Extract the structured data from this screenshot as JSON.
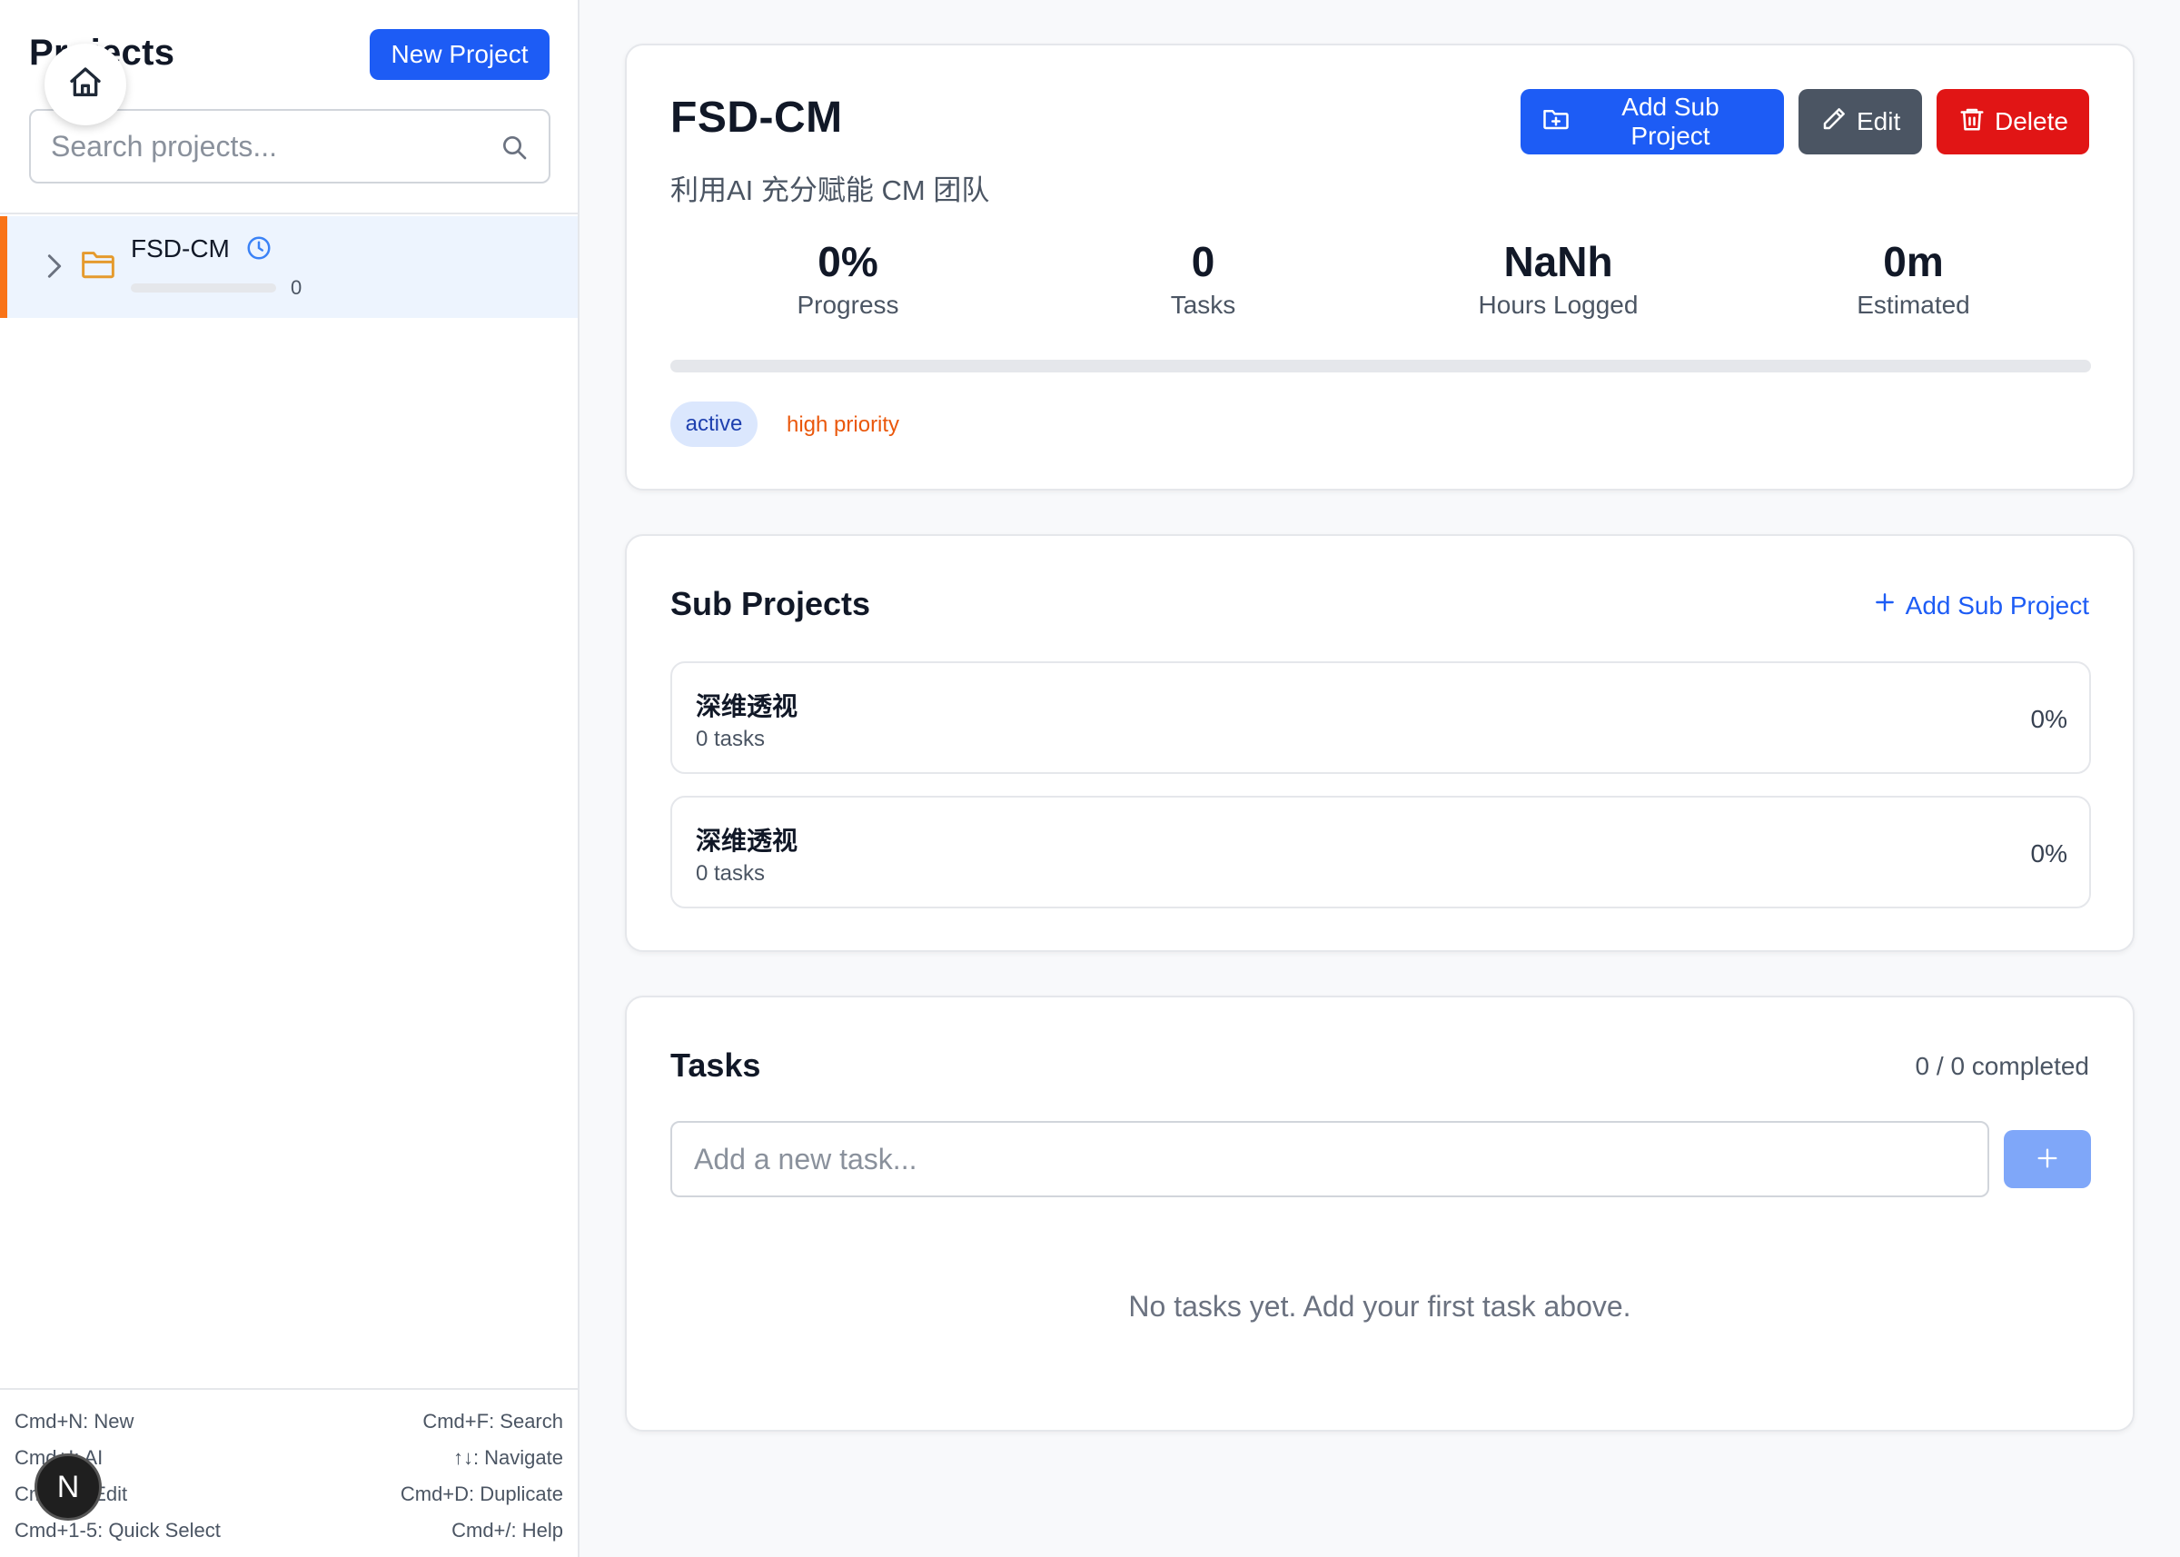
{
  "sidebar": {
    "title": "Projects",
    "new_button": "New Project",
    "search_placeholder": "Search projects...",
    "tree": [
      {
        "name": "FSD-CM",
        "count": "0",
        "progress": 0
      }
    ],
    "shortcuts": {
      "left": [
        "Cmd+N: New",
        "Cmd+I: AI",
        "Cmd+E: Edit",
        "Cmd+1-5: Quick Select"
      ],
      "right": [
        "Cmd+F: Search",
        "↑↓: Navigate",
        "Cmd+D: Duplicate",
        "Cmd+/: Help"
      ]
    },
    "badge": "N"
  },
  "project": {
    "title": "FSD-CM",
    "description": "利用AI 充分赋能 CM 团队",
    "buttons": {
      "add_sub": "Add Sub Project",
      "edit": "Edit",
      "delete": "Delete"
    },
    "stats": [
      {
        "value": "0%",
        "label": "Progress"
      },
      {
        "value": "0",
        "label": "Tasks"
      },
      {
        "value": "NaNh",
        "label": "Hours Logged"
      },
      {
        "value": "0m",
        "label": "Estimated"
      }
    ],
    "progress": 0,
    "status_tag": "active",
    "priority_tag": "high priority"
  },
  "sub_projects": {
    "title": "Sub Projects",
    "add_link": "Add Sub Project",
    "items": [
      {
        "name": "深维透视",
        "tasks": "0 tasks",
        "percent": "0%"
      },
      {
        "name": "深维透视",
        "tasks": "0 tasks",
        "percent": "0%"
      }
    ]
  },
  "tasks": {
    "title": "Tasks",
    "completed": "0 / 0 completed",
    "input_placeholder": "Add a new task...",
    "empty_message": "No tasks yet. Add your first task above."
  },
  "colors": {
    "accent": "#1d5cf5",
    "danger": "#e11515",
    "neutral_button": "#4b5563",
    "selected_row_bg": "#edf4fe",
    "selected_row_border": "#f97316",
    "folder": "#e59a2c",
    "priority": "#ea580c"
  },
  "icons": {
    "home": "home-icon",
    "search": "search-icon",
    "chevron": "chevron-right-icon",
    "folder": "folder-icon",
    "clock": "clock-icon",
    "folder_plus": "folder-plus-icon",
    "pencil": "pencil-icon",
    "trash": "trash-icon",
    "plus": "plus-icon"
  }
}
